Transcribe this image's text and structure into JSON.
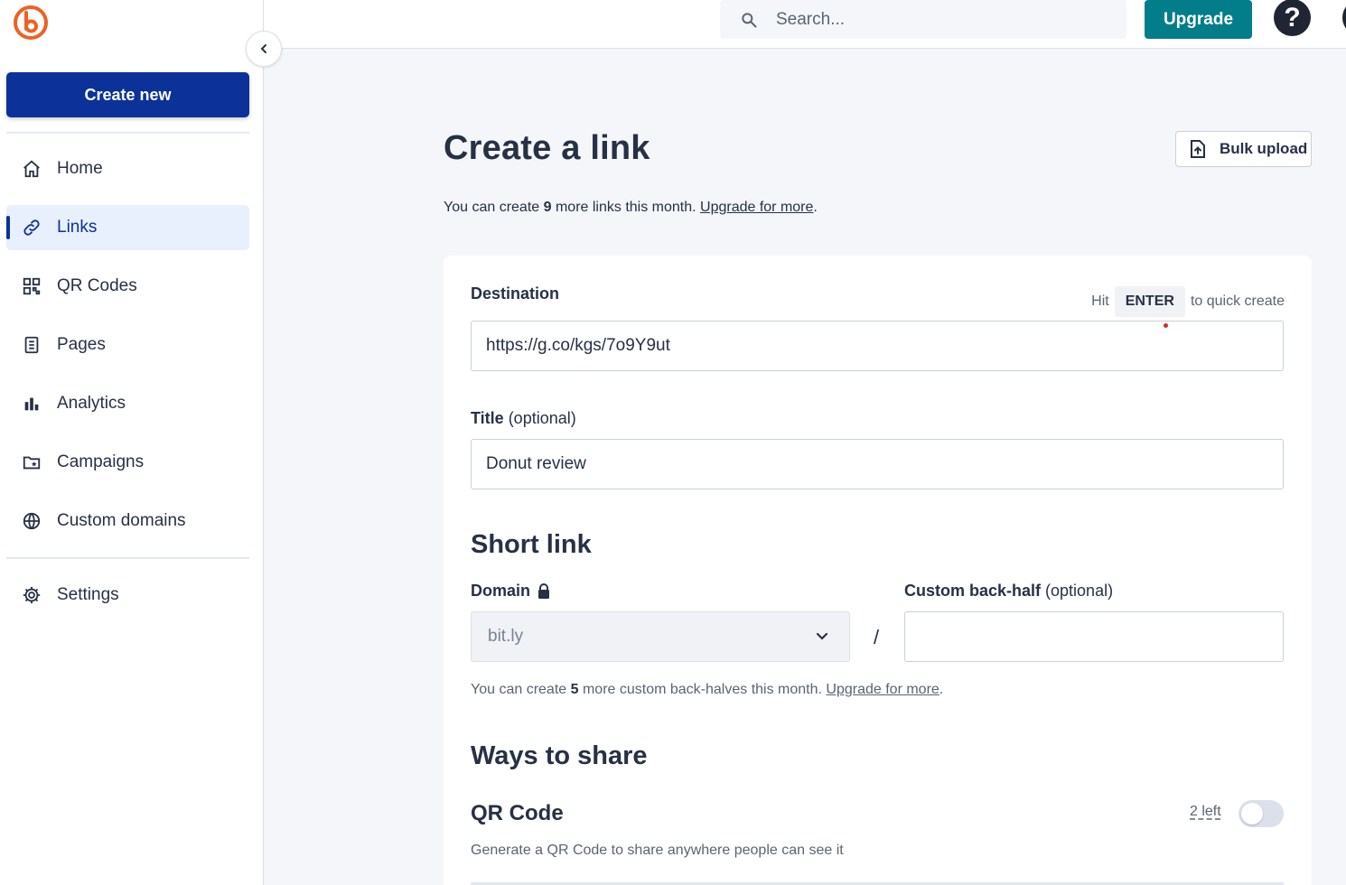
{
  "sidebar": {
    "create_new": "Create new",
    "items": [
      {
        "label": "Home",
        "icon": "home-icon"
      },
      {
        "label": "Links",
        "icon": "link-icon",
        "active": true
      },
      {
        "label": "QR Codes",
        "icon": "qr-code-icon"
      },
      {
        "label": "Pages",
        "icon": "page-icon"
      },
      {
        "label": "Analytics",
        "icon": "bar-chart-icon"
      },
      {
        "label": "Campaigns",
        "icon": "campaign-icon"
      },
      {
        "label": "Custom domains",
        "icon": "globe-icon"
      }
    ],
    "settings": {
      "label": "Settings",
      "icon": "gear-icon"
    }
  },
  "topbar": {
    "search_placeholder": "Search...",
    "upgrade": "Upgrade",
    "help": "?"
  },
  "main": {
    "title": "Create a link",
    "bulk_upload": "Bulk upload",
    "quota_prefix": "You can create ",
    "quota_count": "9",
    "quota_suffix": " more links this month. ",
    "quota_link": "Upgrade for more",
    "quota_end": "."
  },
  "form": {
    "destination_label": "Destination",
    "hint_hit": "Hit",
    "hint_key": "ENTER",
    "hint_suffix": "to quick create",
    "destination_value": "https://g.co/kgs/7o9Y9ut",
    "title_label": "Title",
    "title_optional": " (optional)",
    "title_value": "Donut review",
    "short_link_heading": "Short link",
    "domain_label": "Domain",
    "domain_value": "bit.ly",
    "slash": "/",
    "backhalf_label": "Custom back-half",
    "backhalf_optional": " (optional)",
    "backhalf_value": "",
    "backhalf_quota_prefix": "You can create ",
    "backhalf_quota_count": "5",
    "backhalf_quota_suffix": " more custom back-halves this month. ",
    "backhalf_quota_link": "Upgrade for more",
    "backhalf_quota_end": ".",
    "ways_heading": "Ways to share",
    "qr_title": "QR Code",
    "qr_left": "2 left",
    "qr_enabled": false,
    "qr_description": "Generate a QR Code to share anywhere people can see it"
  },
  "colors": {
    "brand_blue": "#0c3199",
    "upgrade_teal": "#027e8a",
    "logo_orange": "#ee6123"
  }
}
